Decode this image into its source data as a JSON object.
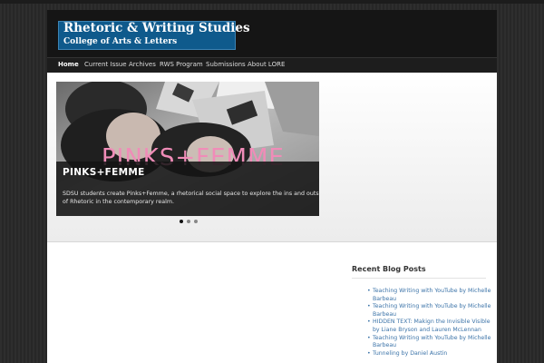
{
  "header": {
    "title": "Rhetoric & Writing Studies",
    "subtitle": "College of Arts & Letters"
  },
  "nav": {
    "items": [
      "Home",
      "Current Issue",
      "Archives",
      "RWS Program",
      "Submissions",
      "About LORE"
    ],
    "active": "Home"
  },
  "slider": {
    "image_text": "PINKS+FEMME",
    "heading": "PINKS+FEMME",
    "caption": "SDSU students create Pinks+Femme, a rhetorical social space to explore the ins and outs of Rhetoric in the contemporary realm.",
    "dots": 3,
    "active_dot": 1
  },
  "sidebar": {
    "widget_title": "Recent Blog Posts",
    "posts": [
      "Teaching Writing with YouTube by Michelle Barbeau",
      "Teaching Writing with YouTube by Michelle Barbeau",
      "HIDDEN TEXT: Makign the Invisible Visible by Liane Bryson and Lauren McLennan",
      "Teaching Writing with YouTube by Michelle Barbeau",
      "Tunneling by Daniel Austin"
    ]
  },
  "colors": {
    "logo_bg": "#0f5a8c",
    "link": "#3b73a8",
    "pink_text": "#f08cb8"
  }
}
